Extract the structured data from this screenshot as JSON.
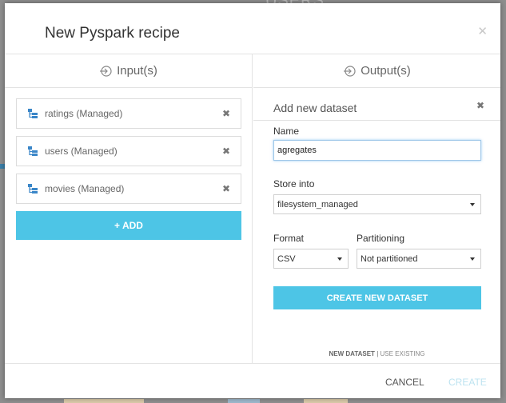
{
  "colors": {
    "accent": "#4dc5e6",
    "disabled_text": "#bde3f0",
    "border": "#dcdcdc",
    "focus_border": "#9fc7e8"
  },
  "modal": {
    "title": "New Pyspark recipe",
    "close_icon": "close-icon"
  },
  "inputs": {
    "header": "Input(s)",
    "items": [
      {
        "label": "ratings (Managed)",
        "icon": "dataset-icon"
      },
      {
        "label": "users (Managed)",
        "icon": "dataset-icon"
      },
      {
        "label": "movies (Managed)",
        "icon": "dataset-icon"
      }
    ],
    "add_label": "+ ADD"
  },
  "outputs": {
    "header": "Output(s)",
    "new_dataset": {
      "title": "Add new dataset",
      "name_label": "Name",
      "name_value": "agregates",
      "store_label": "Store into",
      "store_value": "filesystem_managed",
      "format_label": "Format",
      "format_value": "CSV",
      "partition_label": "Partitioning",
      "partition_value": "Not partitioned",
      "create_label": "CREATE NEW DATASET"
    },
    "mode": {
      "new_label": "NEW DATASET",
      "separator": "|",
      "existing_label": "USE EXISTING"
    }
  },
  "footer": {
    "cancel_label": "CANCEL",
    "create_label": "CREATE"
  },
  "background": {
    "text": "USERS"
  }
}
